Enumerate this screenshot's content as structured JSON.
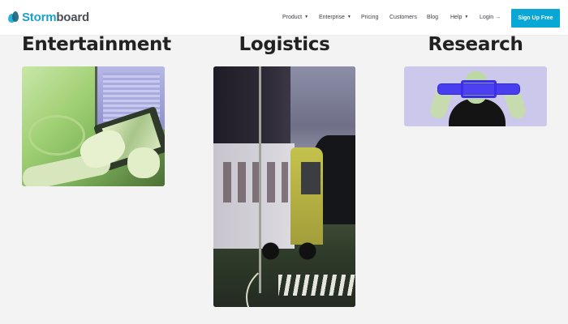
{
  "brand": {
    "part1": "Storm",
    "part2": "board",
    "colors": {
      "accent": "#1aa3c8",
      "dark": "#4a4f55"
    }
  },
  "nav": {
    "items": [
      {
        "label": "Product",
        "has_caret": true
      },
      {
        "label": "Enterprise",
        "has_caret": true
      },
      {
        "label": "Pricing",
        "has_caret": false
      },
      {
        "label": "Customers",
        "has_caret": false
      },
      {
        "label": "Blog",
        "has_caret": false
      },
      {
        "label": "Help",
        "has_caret": true
      }
    ],
    "login_label": "Login",
    "login_arrow": "→",
    "signup_label": "Sign Up Free",
    "signup_color": "#08a7d6"
  },
  "sections": [
    {
      "title": "Entertainment"
    },
    {
      "title": "Logistics"
    },
    {
      "title": "Research"
    }
  ]
}
